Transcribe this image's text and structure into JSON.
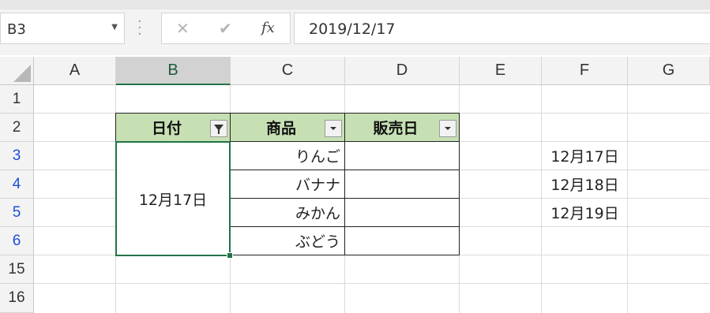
{
  "formula_bar": {
    "name_box": "B3",
    "cancel_icon": "✕",
    "enter_icon": "✔",
    "fx_label": "fx",
    "formula": "2019/12/17"
  },
  "columns": [
    "A",
    "B",
    "C",
    "D",
    "E",
    "F",
    "G"
  ],
  "rows": [
    "1",
    "2",
    "3",
    "4",
    "5",
    "6",
    "15",
    "16"
  ],
  "table": {
    "headers": [
      "日付",
      "商品",
      "販売日"
    ],
    "merged_date": "12月17日",
    "products": [
      "りんご",
      "バナナ",
      "みかん",
      "ぶどう"
    ]
  },
  "side_dates": [
    "12月17日",
    "12月18日",
    "12月19日"
  ],
  "colors": {
    "accent": "#217346",
    "header_fill": "#c6e0b4",
    "row_blue": "#1a4fd6"
  }
}
